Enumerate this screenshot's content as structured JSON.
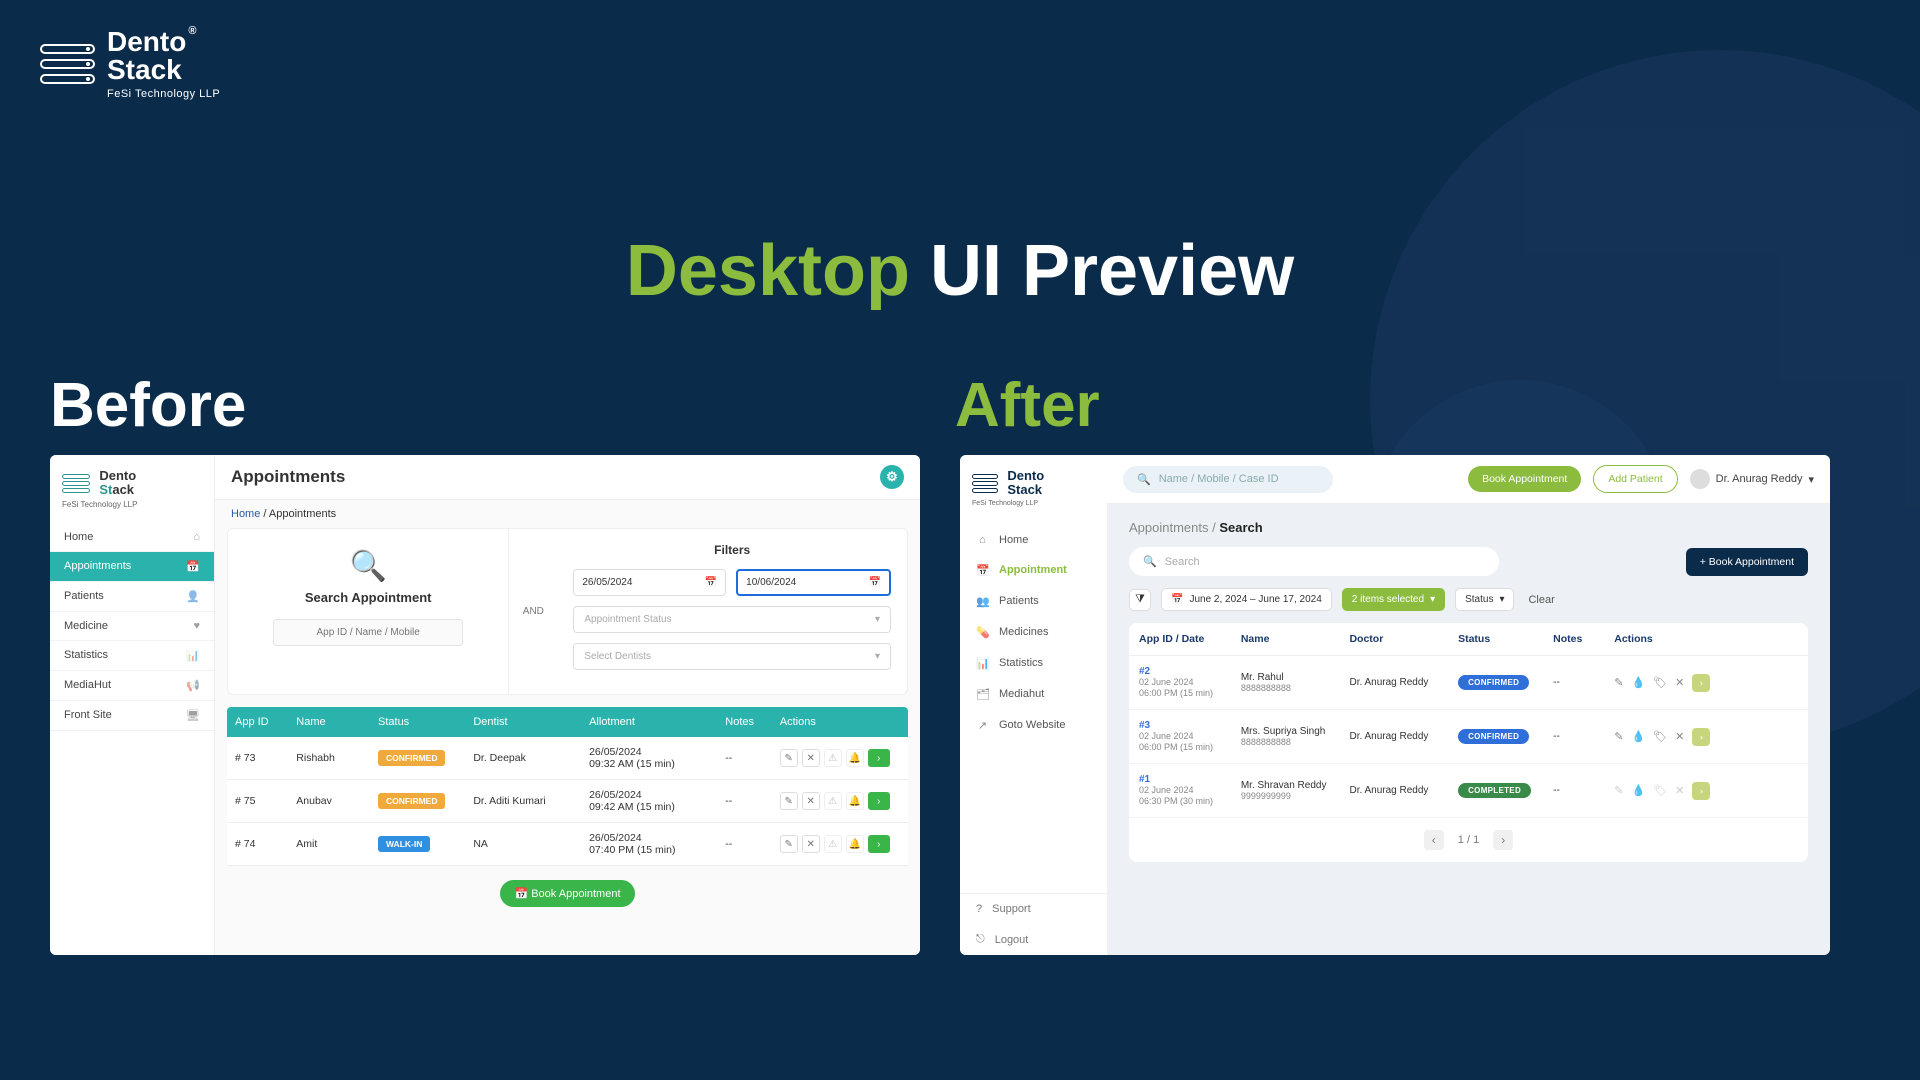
{
  "brand": {
    "line1": "Dento",
    "line2a": "St",
    "line2b": "ack",
    "sub": "FeSi Technology LLP",
    "reg": "®"
  },
  "title": {
    "word1": "Desktop",
    "word2": "UI Preview"
  },
  "labels": {
    "before": "Before",
    "after": "After"
  },
  "before": {
    "logo_sub": "FeSi Technology LLP",
    "nav": [
      "Home",
      "Appointments",
      "Patients",
      "Medicine",
      "Statistics",
      "MediaHut",
      "Front Site"
    ],
    "nav_icons": [
      "⌂",
      "📅",
      "👤",
      "♥",
      "📊",
      "📢",
      "🖥"
    ],
    "active_nav": 1,
    "header": "Appointments",
    "crumb_home": "Home",
    "crumb_sep": " / ",
    "crumb_here": "Appointments",
    "search_title": "Search Appointment",
    "search_ph": "App ID / Name / Mobile",
    "and": "AND",
    "filters_title": "Filters",
    "date_from": "26/05/2024",
    "date_to": "10/06/2024",
    "sel_status": "Appointment Status",
    "sel_dentists": "Select Dentists",
    "thead": [
      "App ID",
      "Name",
      "Status",
      "Dentist",
      "Allotment",
      "Notes",
      "Actions"
    ],
    "rows": [
      {
        "id": "# 73",
        "name": "Rishabh",
        "status": "CONFIRMED",
        "status_cls": "bg-orange",
        "dentist": "Dr. Deepak",
        "allot1": "26/05/2024",
        "allot2": "09:32 AM (15 min)",
        "notes": "--"
      },
      {
        "id": "# 75",
        "name": "Anubav",
        "status": "CONFIRMED",
        "status_cls": "bg-orange",
        "dentist": "Dr. Aditi Kumari",
        "allot1": "26/05/2024",
        "allot2": "09:42 AM (15 min)",
        "notes": "--"
      },
      {
        "id": "# 74",
        "name": "Amit",
        "status": "WALK-IN",
        "status_cls": "bg-blue",
        "dentist": "NA",
        "allot1": "26/05/2024",
        "allot2": "07:40 PM (15 min)",
        "notes": "--"
      }
    ],
    "book_btn": "📅  Book Appointment"
  },
  "after": {
    "logo_sub": "FeSi Technology LLP",
    "top_search_ph": "Name / Mobile / Case ID",
    "btn_book": "Book Appointment",
    "btn_add": "Add Patient",
    "user": "Dr. Anurag Reddy",
    "nav": [
      "Home",
      "Appointment",
      "Patients",
      "Medicines",
      "Statistics",
      "Mediahut",
      "Goto Website"
    ],
    "nav_icons": [
      "⌂",
      "📅",
      "👥",
      "💊",
      "📊",
      "🗂",
      "↗"
    ],
    "active_nav": 1,
    "bottom": [
      "Support",
      "Logout"
    ],
    "bottom_icons": [
      "?",
      "⎋"
    ],
    "crumb_parent": "Appointments",
    "crumb_sep": " / ",
    "crumb_here": "Search",
    "search_ph2": "Search",
    "book_btn2": "+  Book Appointment",
    "filter": {
      "daterange": "June 2, 2024 – June 17, 2024",
      "selected": "2 items selected",
      "status": "Status",
      "clear": "Clear"
    },
    "thead": [
      "App ID / Date",
      "Name",
      "Doctor",
      "Status",
      "Notes",
      "Actions"
    ],
    "rows": [
      {
        "id": "#2",
        "date": "02 June 2024",
        "time": "06:00 PM (15 min)",
        "name": "Mr. Rahul",
        "phone": "8888888888",
        "doctor": "Dr. Anurag Reddy",
        "status": "CONFIRMED",
        "status_cls": "b-conf",
        "notes": "--",
        "faded": false
      },
      {
        "id": "#3",
        "date": "02 June 2024",
        "time": "06:00 PM (15 min)",
        "name": "Mrs. Supriya Singh",
        "phone": "8888888888",
        "doctor": "Dr. Anurag Reddy",
        "status": "CONFIRMED",
        "status_cls": "b-conf",
        "notes": "--",
        "faded": false
      },
      {
        "id": "#1",
        "date": "02 June 2024",
        "time": "06:30 PM (30 min)",
        "name": "Mr. Shravan Reddy",
        "phone": "9999999999",
        "doctor": "Dr. Anurag Reddy",
        "status": "COMPLETED",
        "status_cls": "b-comp",
        "notes": "--",
        "faded": true
      }
    ],
    "pager": "1 / 1"
  }
}
